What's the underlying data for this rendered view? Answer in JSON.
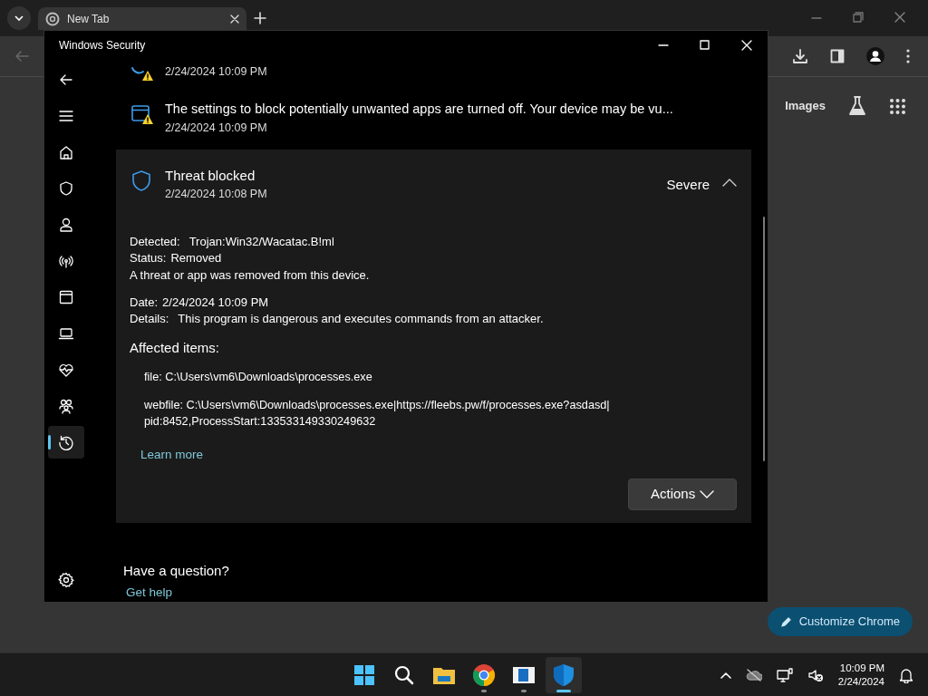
{
  "browser": {
    "tab": {
      "title": "New Tab",
      "selected": true
    },
    "page_links": [
      "Images"
    ],
    "customize_button": "Customize Chrome"
  },
  "window": {
    "title": "Windows Security",
    "sidebar": [
      {
        "kind": "back",
        "selected": false
      },
      {
        "kind": "menu",
        "selected": false
      },
      {
        "kind": "home",
        "selected": false
      },
      {
        "kind": "shield",
        "selected": false
      },
      {
        "kind": "account",
        "selected": false
      },
      {
        "kind": "network",
        "selected": false
      },
      {
        "kind": "app",
        "selected": false
      },
      {
        "kind": "device",
        "selected": false
      },
      {
        "kind": "health",
        "selected": false
      },
      {
        "kind": "family",
        "selected": false
      },
      {
        "kind": "history",
        "selected": true
      },
      {
        "kind": "settings",
        "selected": false
      }
    ],
    "history": [
      {
        "kind": "partial",
        "date": "2/24/2024 10:09 PM"
      },
      {
        "kind": "app-warning",
        "title": "The settings to block potentially unwanted apps are turned off. Your device may be vu...",
        "date": "2/24/2024 10:09 PM"
      }
    ],
    "threat": {
      "title": "Threat blocked",
      "date": "2/24/2024 10:08 PM",
      "severity": "Severe",
      "expanded": true,
      "fields": [
        {
          "label": "Detected:",
          "value": "Trojan:Win32/Wacatac.B!ml"
        },
        {
          "label": "Status:",
          "value": "Removed"
        }
      ],
      "note": "A threat or app was removed from this device.",
      "fields2": [
        {
          "label": "Date:",
          "value": "2/24/2024 10:09 PM"
        },
        {
          "label": "Details:",
          "value": "This program is dangerous and executes commands from an attacker."
        }
      ],
      "affected_heading": "Affected items:",
      "affected_items": [
        {
          "lines": [
            "file: C:\\Users\\vm6\\Downloads\\processes.exe"
          ]
        },
        {
          "lines": [
            "webfile: C:\\Users\\vm6\\Downloads\\processes.exe|https://fleebs.pw/f/processes.exe?asdasd|",
            "pid:8452,ProcessStart:133533149330249632"
          ]
        }
      ],
      "learn_more": "Learn more",
      "actions_button": "Actions"
    },
    "question": {
      "heading": "Have a question?",
      "link": "Get help"
    }
  },
  "taskbar": {
    "apps": [
      {
        "kind": "start",
        "running": false,
        "active": false
      },
      {
        "kind": "search",
        "running": false,
        "active": false
      },
      {
        "kind": "explorer",
        "running": false,
        "active": false
      },
      {
        "kind": "chrome",
        "running": true,
        "active": false
      },
      {
        "kind": "viewer",
        "running": true,
        "active": false
      },
      {
        "kind": "defender",
        "running": true,
        "active": true
      }
    ],
    "time": "10:09 PM",
    "date": "2/24/2024"
  }
}
